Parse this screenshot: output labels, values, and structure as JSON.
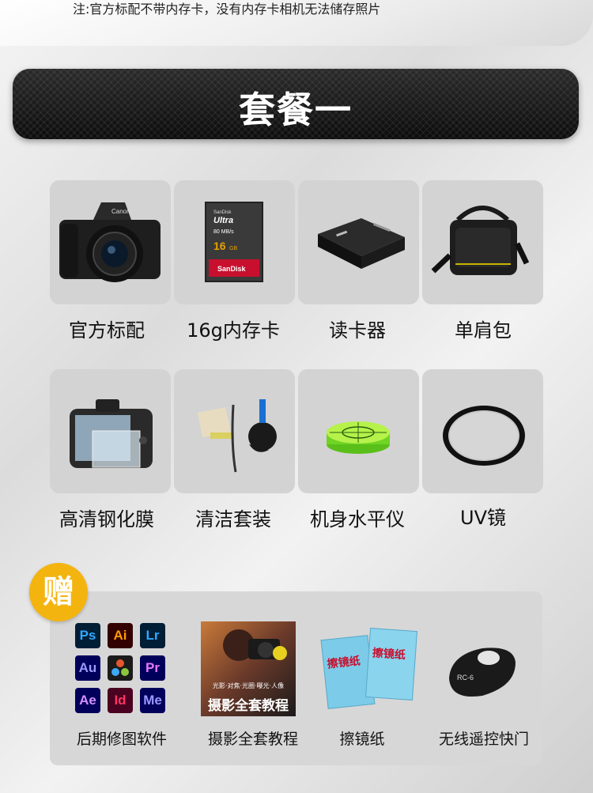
{
  "note": "注:官方标配不带内存卡，没有内存卡相机无法储存照片",
  "banner_title": "套餐一",
  "items": [
    {
      "label": "官方标配",
      "icon": "dslr-camera-icon"
    },
    {
      "label": "16g内存卡",
      "icon": "sd-card-icon"
    },
    {
      "label": "读卡器",
      "icon": "card-reader-icon"
    },
    {
      "label": "单肩包",
      "icon": "camera-bag-icon"
    },
    {
      "label": "高清钢化膜",
      "icon": "screen-protector-icon"
    },
    {
      "label": "清洁套装",
      "icon": "cleaning-kit-icon"
    },
    {
      "label": "机身水平仪",
      "icon": "bubble-level-icon"
    },
    {
      "label": "UV镜",
      "icon": "uv-filter-icon"
    }
  ],
  "gift_badge": "赠",
  "gifts": [
    {
      "label": "后期修图软件",
      "icon": "software-icons"
    },
    {
      "label": "摄影全套教程",
      "icon": "tutorial-cover-icon"
    },
    {
      "label": "擦镜纸",
      "icon": "lens-paper-icon"
    },
    {
      "label": "无线遥控快门",
      "icon": "remote-shutter-icon"
    }
  ],
  "sd_card": {
    "brand_small": "SanDisk",
    "line": "Ultra",
    "speed": "80 MB/s",
    "capacity": "16",
    "unit": "GB",
    "brand": "SanDisk"
  },
  "camera_brand": "Canon",
  "apps": [
    "Ps",
    "Ai",
    "Lr",
    "Au",
    "",
    "Pr",
    "Ae",
    "Id",
    "Me"
  ],
  "tutorial": {
    "subtitle": "光影·对焦·光圈·曝光·人像",
    "title": "摄影全套教程"
  },
  "lens_paper": {
    "title": "擦镜纸"
  },
  "remote": {
    "model": "RC-6"
  }
}
